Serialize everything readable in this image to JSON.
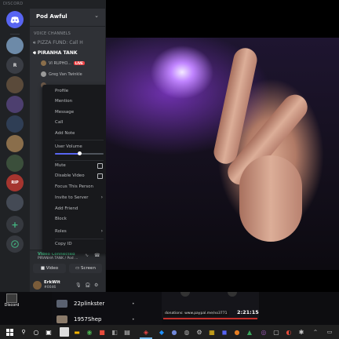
{
  "window": {
    "app_name": "DISCORD"
  },
  "guild": {
    "name": "Pod Awful"
  },
  "channels": {
    "category": "VOICE CHANNELS",
    "list": [
      {
        "name": "PIZZA FUND: Call H",
        "active": false
      },
      {
        "name": "PIRANHA TANK",
        "active": true
      }
    ],
    "voice_users": [
      {
        "name": "VI RUPHO...",
        "badge": "LIVE"
      },
      {
        "name": "Greg Van Twinkle",
        "badge": ""
      }
    ]
  },
  "context_menu": {
    "items": [
      {
        "label": "Profile"
      },
      {
        "label": "Mention"
      },
      {
        "label": "Message"
      },
      {
        "label": "Call"
      },
      {
        "label": "Add Note"
      }
    ],
    "volume_label": "User Volume",
    "volume_level": 0.5,
    "toggles": [
      {
        "label": "Mute"
      },
      {
        "label": "Disable Video"
      }
    ],
    "actions": [
      {
        "label": "Focus This Person"
      },
      {
        "label": "Invite to Server"
      },
      {
        "label": "Add Friend"
      },
      {
        "label": "Block"
      },
      {
        "label": "Roles"
      }
    ],
    "copy_id": "Copy ID"
  },
  "voice_panel": {
    "status": "Video Connected",
    "channel": "PIRANHA TANK / Pod ...",
    "video_button": "Video",
    "screen_button": "Screen"
  },
  "user": {
    "name": "ErkWit",
    "tag": "#0046"
  },
  "stream": {
    "donation_url": "donations: www.paypal.me/no3771",
    "timer": "2:21:15"
  },
  "side_list": [
    {
      "name": "22plinkster"
    },
    {
      "name": "1957Shep"
    }
  ],
  "desktop": {
    "icon_label": "Discord"
  },
  "colors": {
    "accent": "#5865f2",
    "online": "#43b581",
    "live": "#ed4245",
    "discord_bg": "#202225"
  }
}
